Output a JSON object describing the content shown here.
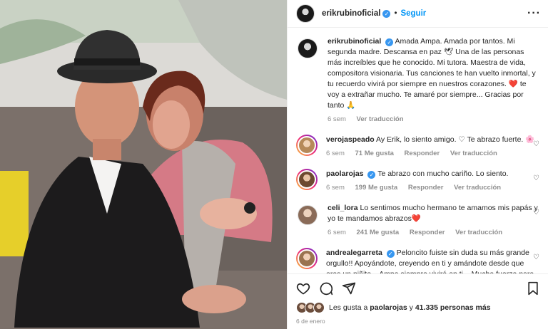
{
  "post": {
    "username": "erikrubinoficial",
    "follow_label": "Seguir",
    "caption_text": "Amada Ampa. Amada por tantos. Mi segunda madre. Descansa en paz 🕊 Una de las personas más increíbles que he conocido. Mi tutora. Maestra de vida, compositora visionaria. Tus canciones te han vuelto inmortal, y tu recuerdo vivirá por siempre en nuestros corazones. ❤️ te voy a extrañar mucho. Te amaré por siempre... Gracias por tanto 🙏",
    "caption_time": "6 sem",
    "caption_translation": "Ver traducción"
  },
  "comments": [
    {
      "username": "verojaspeado",
      "text": "Ay Erik, lo siento amigo. ♡ Te abrazo fuerte. 🌸",
      "time": "6 sem",
      "likes": "71 Me gusta",
      "reply": "Responder",
      "translate": "Ver traducción",
      "verified": false
    },
    {
      "username": "paolarojas",
      "text": "Te abrazo con mucho cariño. Lo siento.",
      "time": "6 sem",
      "likes": "199 Me gusta",
      "reply": "Responder",
      "translate": "Ver traducción",
      "verified": true
    },
    {
      "username": "celi_lora",
      "text": "Lo sentimos mucho hermano te amamos mis papás y yo te mandamos abrazos❤️",
      "time": "6 sem",
      "likes": "241 Me gusta",
      "reply": "Responder",
      "translate": "Ver traducción",
      "verified": false
    },
    {
      "username": "andrealegarreta",
      "text": "Peloncito fuiste sin duda su más grande orgullo!! Apoyándote, creyendo en ti y amándote desde que eras un niñito... Ampa siempre vivirá en ti... Mucha fuerza para",
      "verified": true
    }
  ],
  "likes_summary": {
    "prefix": "Les gusta a",
    "user": "paolarojas",
    "connector": "y",
    "count": "41.335 personas más"
  },
  "date": "6 de enero",
  "icons": [
    "heart-icon",
    "comment-icon",
    "share-icon",
    "bookmark-icon",
    "more-options-icon",
    "verified-icon"
  ]
}
